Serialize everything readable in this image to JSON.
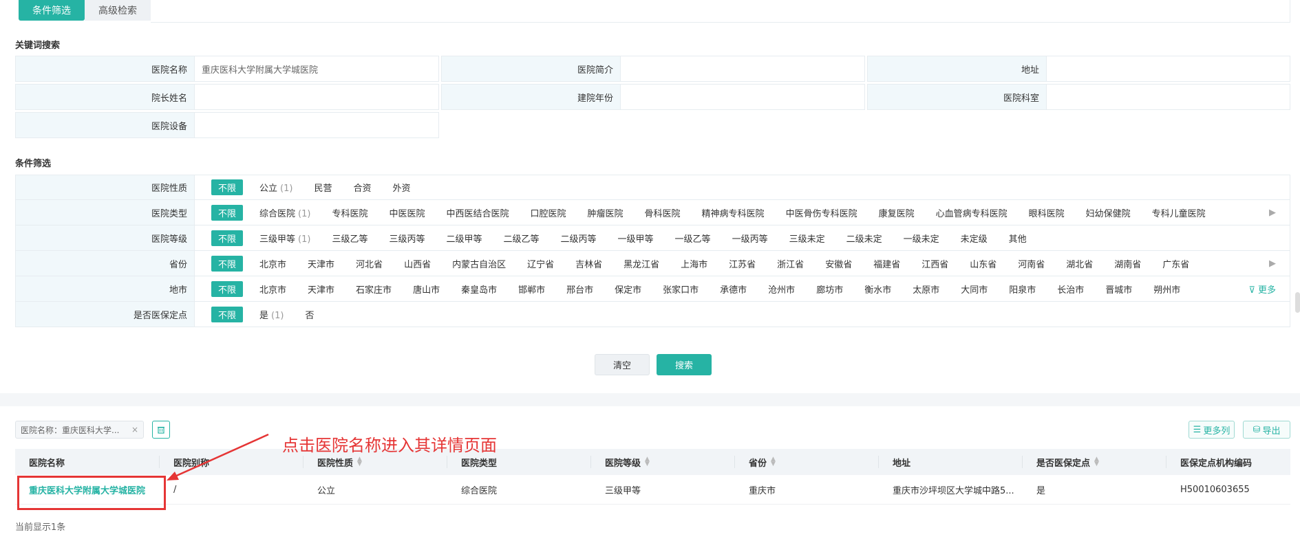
{
  "tabs": {
    "active": "条件筛选",
    "inactive": "高级检索"
  },
  "keyword_section": {
    "title": "关键词搜索",
    "fields": [
      {
        "label": "医院名称",
        "value": "重庆医科大学附属大学城医院"
      },
      {
        "label": "医院简介",
        "value": ""
      },
      {
        "label": "地址",
        "value": ""
      },
      {
        "label": "院长姓名",
        "value": ""
      },
      {
        "label": "建院年份",
        "value": ""
      },
      {
        "label": "医院科室",
        "value": ""
      },
      {
        "label": "医院设备",
        "value": ""
      }
    ]
  },
  "filter_section": {
    "title": "条件筛选",
    "all_label": "不限",
    "more_label": "更多",
    "rows": [
      {
        "label": "医院性质",
        "options": [
          "公立",
          "民营",
          "合资",
          "外资"
        ],
        "counts": {
          "0": "(1)"
        }
      },
      {
        "label": "医院类型",
        "options": [
          "综合医院",
          "专科医院",
          "中医医院",
          "中西医结合医院",
          "口腔医院",
          "肿瘤医院",
          "骨科医院",
          "精神病专科医院",
          "中医骨伤专科医院",
          "康复医院",
          "心血管病专科医院",
          "眼科医院",
          "妇幼保健院",
          "专科儿童医院"
        ],
        "counts": {
          "0": "(1)"
        }
      },
      {
        "label": "医院等级",
        "options": [
          "三级甲等",
          "三级乙等",
          "三级丙等",
          "二级甲等",
          "二级乙等",
          "二级丙等",
          "一级甲等",
          "一级乙等",
          "一级丙等",
          "三级未定",
          "二级未定",
          "一级未定",
          "未定级",
          "其他"
        ],
        "counts": {
          "0": "(1)"
        }
      },
      {
        "label": "省份",
        "options": [
          "北京市",
          "天津市",
          "河北省",
          "山西省",
          "内蒙古自治区",
          "辽宁省",
          "吉林省",
          "黑龙江省",
          "上海市",
          "江苏省",
          "浙江省",
          "安徽省",
          "福建省",
          "江西省",
          "山东省",
          "河南省",
          "湖北省",
          "湖南省",
          "广东省"
        ],
        "counts": {}
      },
      {
        "label": "地市",
        "options": [
          "北京市",
          "天津市",
          "石家庄市",
          "唐山市",
          "秦皇岛市",
          "邯郸市",
          "邢台市",
          "保定市",
          "张家口市",
          "承德市",
          "沧州市",
          "廊坊市",
          "衡水市",
          "太原市",
          "大同市",
          "阳泉市",
          "长治市",
          "晋城市",
          "朔州市"
        ],
        "counts": {}
      },
      {
        "label": "是否医保定点",
        "options": [
          "是",
          "否"
        ],
        "counts": {
          "0": "(1)"
        }
      }
    ]
  },
  "buttons": {
    "clear": "清空",
    "search": "搜索"
  },
  "results": {
    "chip": "医院名称：重庆医科大学...",
    "chip_close": "×",
    "more_columns": "更多列",
    "export": "导出",
    "columns": [
      "医院名称",
      "医院别称",
      "医院性质",
      "医院类型",
      "医院等级",
      "省份",
      "地址",
      "是否医保定点",
      "医保定点机构编码"
    ],
    "rows": [
      [
        "重庆医科大学附属大学城医院",
        "/",
        "公立",
        "综合医院",
        "三级甲等",
        "重庆市",
        "重庆市沙坪坝区大学城中路5...",
        "是",
        "H50010603655"
      ]
    ],
    "footer": "当前显示1条"
  },
  "annotation": "点击医院名称进入其详情页面",
  "colors": {
    "accent": "#26b3a4",
    "annotation": "#e53535"
  }
}
